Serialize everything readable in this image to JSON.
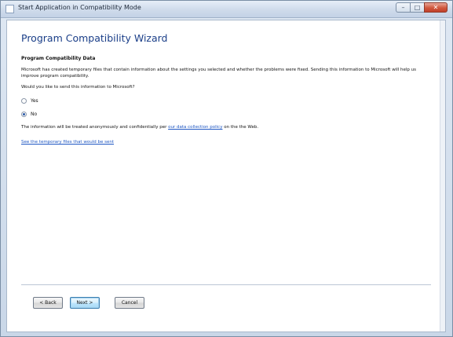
{
  "window": {
    "title": "Start Application in Compatibility Mode",
    "controls": {
      "minimize": "–",
      "maximize": "□",
      "close": "✕"
    }
  },
  "wizard": {
    "heading": "Program Compatibility Wizard",
    "subheading": "Program Compatibility Data",
    "description": "Microsoft has created temporary files that contain information about the settings you selected and whether the problems were fixed. Sending this information to Microsoft will help us improve program compatibility.",
    "question": "Would you like to send this information to Microsoft?",
    "options": [
      {
        "label": "Yes",
        "checked": false
      },
      {
        "label": "No",
        "checked": true
      }
    ],
    "info_prefix": "The information will be treated anonymously and confidentially per ",
    "info_link": "our data collection policy",
    "info_suffix": " on the the Web.",
    "files_link": "See the temporary files that would be sent"
  },
  "buttons": {
    "back": "< Back",
    "next": "Next >",
    "cancel": "Cancel"
  }
}
